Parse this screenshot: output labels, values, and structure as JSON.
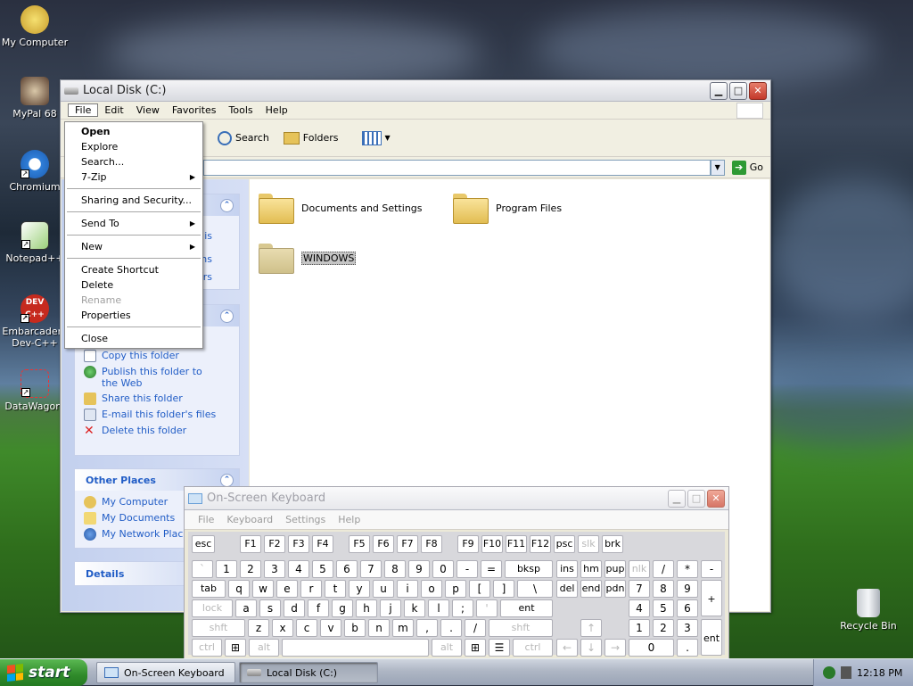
{
  "desktop": {
    "icons": [
      {
        "label": "My Computer",
        "icon": "my-computer-icon"
      },
      {
        "label": "MyPal 68",
        "icon": "mypal-icon"
      },
      {
        "label": "Chromium",
        "icon": "chromium-icon"
      },
      {
        "label": "Notepad++",
        "icon": "notepadpp-icon"
      },
      {
        "label": "Embarcadero Dev-C++",
        "icon": "devcpp-icon",
        "badge": "DEV C++"
      },
      {
        "label": "DataWagon.",
        "icon": "datawagon-icon"
      },
      {
        "label": "Recycle Bin",
        "icon": "recycle-bin-icon"
      }
    ]
  },
  "explorer": {
    "title": "Local Disk (C:)",
    "menu": [
      "File",
      "Edit",
      "View",
      "Favorites",
      "Tools",
      "Help"
    ],
    "toolbar": {
      "search": "Search",
      "folders": "Folders"
    },
    "go_label": "Go",
    "panels": {
      "file_tasks": {
        "partial": [
          "is",
          "ms",
          "ers"
        ],
        "items": [
          "Copy this folder",
          "Publish this folder to the Web",
          "Share this folder",
          "E-mail this folder's files",
          "Delete this folder"
        ]
      },
      "other_places": {
        "title": "Other Places",
        "items": [
          "My Computer",
          "My Documents",
          "My Network Places"
        ]
      },
      "details": {
        "title": "Details"
      }
    },
    "files": [
      "Documents and Settings",
      "Program Files",
      "WINDOWS"
    ]
  },
  "file_menu": {
    "items": [
      {
        "label": "Open",
        "bold": true
      },
      {
        "label": "Explore"
      },
      {
        "label": "Search..."
      },
      {
        "label": "7-Zip",
        "sub": true
      },
      {
        "sep": true
      },
      {
        "label": "Sharing and Security..."
      },
      {
        "sep": true
      },
      {
        "label": "Send To",
        "sub": true
      },
      {
        "sep": true
      },
      {
        "label": "New",
        "sub": true
      },
      {
        "sep": true
      },
      {
        "label": "Create Shortcut"
      },
      {
        "label": "Delete"
      },
      {
        "label": "Rename",
        "disabled": true
      },
      {
        "label": "Properties"
      },
      {
        "sep": true
      },
      {
        "label": "Close"
      }
    ]
  },
  "osk": {
    "title": "On-Screen Keyboard",
    "menu": [
      "File",
      "Keyboard",
      "Settings",
      "Help"
    ]
  },
  "taskbar": {
    "start": "start",
    "tasks": [
      "On-Screen Keyboard",
      "Local Disk (C:)"
    ],
    "clock": "12:18 PM"
  },
  "colors": {
    "accent": "#215dc6",
    "start_green": "#2f8a2a",
    "close_red": "#c4382a"
  }
}
